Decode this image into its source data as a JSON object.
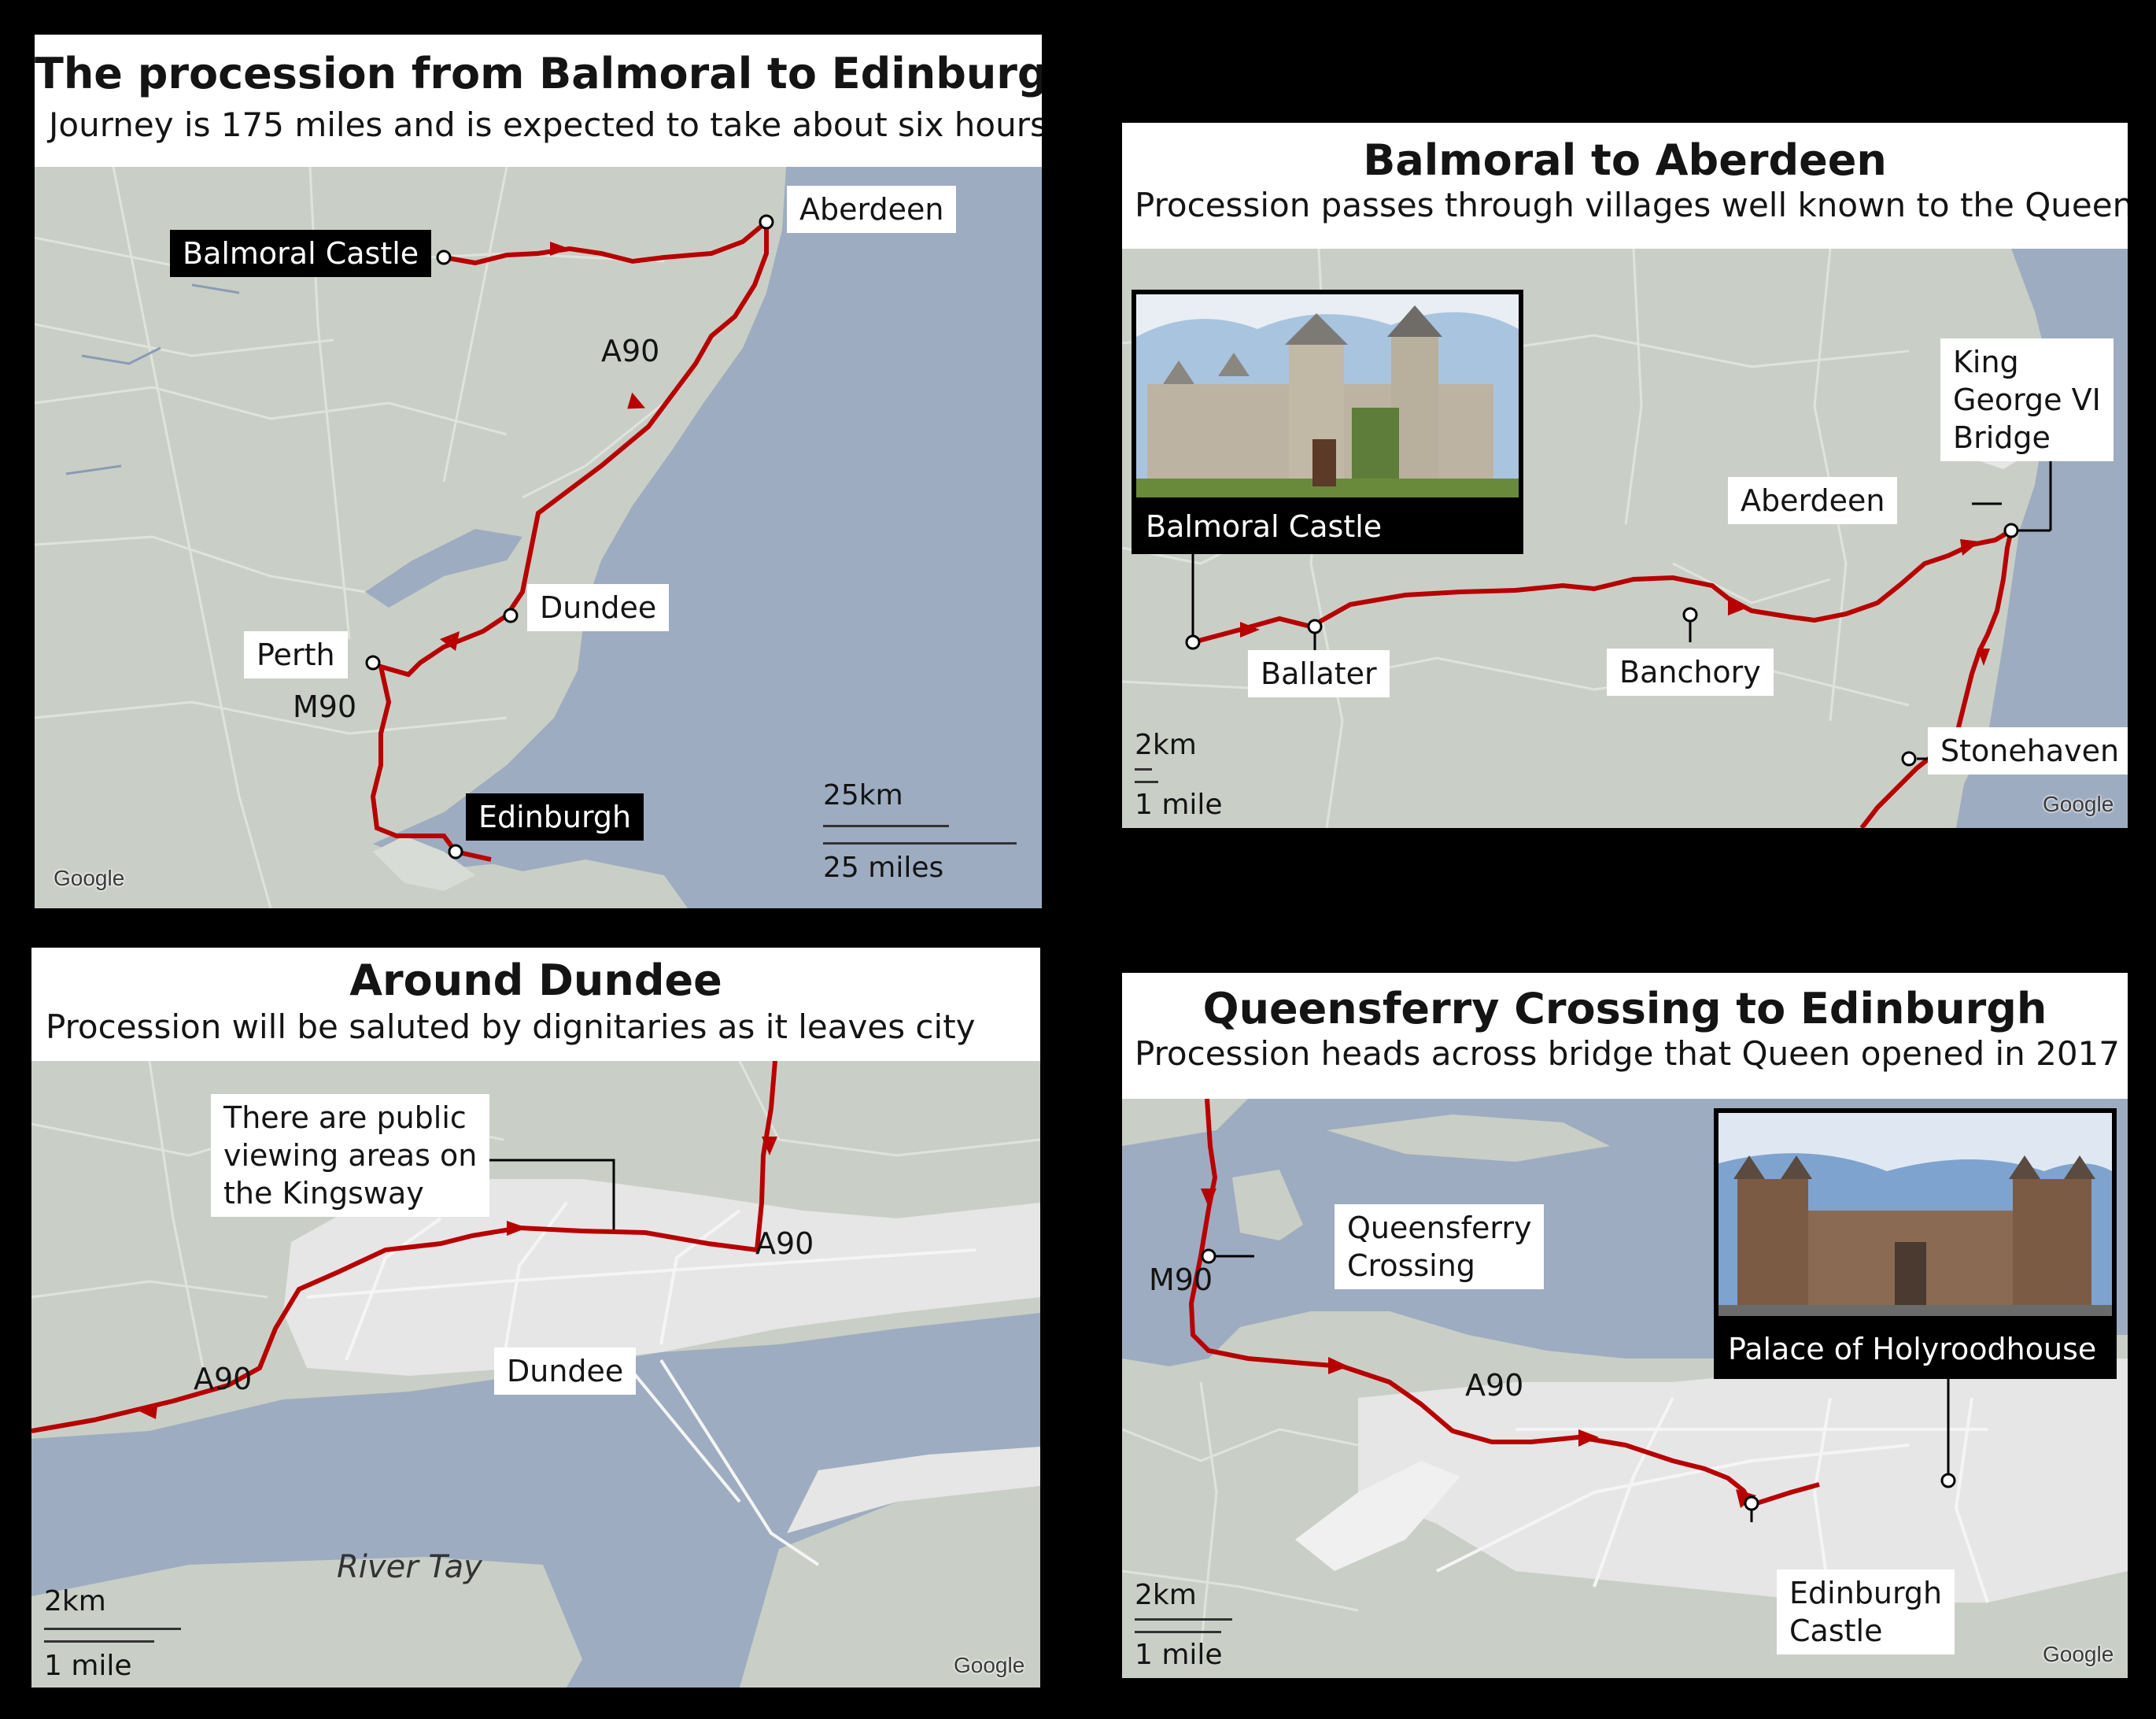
{
  "colors": {
    "background": "#000000",
    "land": "#c9cfc6",
    "water": "#9eacc1",
    "urban": "#e6e6e6",
    "route": "#b80000",
    "label_bg": "#ffffff",
    "dark_label_bg": "#000000"
  },
  "panel1": {
    "title": "The procession from Balmoral to Edinburgh",
    "subtitle": "Journey is 175 miles and is expected to take about six hours",
    "labels": {
      "balmoral": "Balmoral Castle",
      "aberdeen": "Aberdeen",
      "dundee": "Dundee",
      "perth": "Perth",
      "edinburgh": "Edinburgh"
    },
    "roads": {
      "a90": "A90",
      "m90": "M90"
    },
    "scale": {
      "km": "25km",
      "miles": "25 miles"
    },
    "attribution": "Google"
  },
  "panel2": {
    "title": "Balmoral to Aberdeen",
    "subtitle": "Procession passes through villages well known to the Queen",
    "photo_caption": "Balmoral Castle",
    "labels": {
      "king_george": "King\nGeorge VI\nBridge",
      "aberdeen": "Aberdeen",
      "ballater": "Ballater",
      "banchory": "Banchory",
      "stonehaven": "Stonehaven"
    },
    "scale": {
      "km": "2km",
      "miles": "1 mile"
    },
    "attribution": "Google"
  },
  "panel3": {
    "title": "Around Dundee",
    "subtitle": "Procession will be saluted by dignitaries as it leaves city",
    "labels": {
      "viewing": "There are public\nviewing areas on\nthe Kingsway",
      "dundee": "Dundee"
    },
    "roads": {
      "a90_east": "A90",
      "a90_west": "A90"
    },
    "river": "River Tay",
    "scale": {
      "km": "2km",
      "miles": "1 mile"
    },
    "attribution": "Google"
  },
  "panel4": {
    "title": "Queensferry Crossing to Edinburgh",
    "subtitle": "Procession heads across bridge that Queen opened in 2017",
    "photo_caption": "Palace of Holyroodhouse",
    "labels": {
      "queensferry": "Queensferry\nCrossing",
      "edinburgh_castle": "Edinburgh\nCastle"
    },
    "roads": {
      "m90": "M90",
      "a90": "A90"
    },
    "scale": {
      "km": "2km",
      "miles": "1 mile"
    },
    "attribution": "Google"
  }
}
